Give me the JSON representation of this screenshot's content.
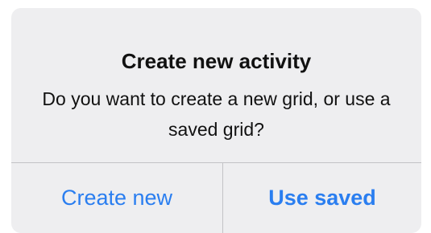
{
  "dialog": {
    "title": "Create new activity",
    "message": "Do you want to create a new grid, or use a saved grid?",
    "buttons": {
      "create_new": "Create new",
      "use_saved": "Use saved"
    }
  },
  "colors": {
    "button_text": "#2a7ef0",
    "dialog_background": "#eeeef0",
    "divider": "#c3c3c6"
  }
}
